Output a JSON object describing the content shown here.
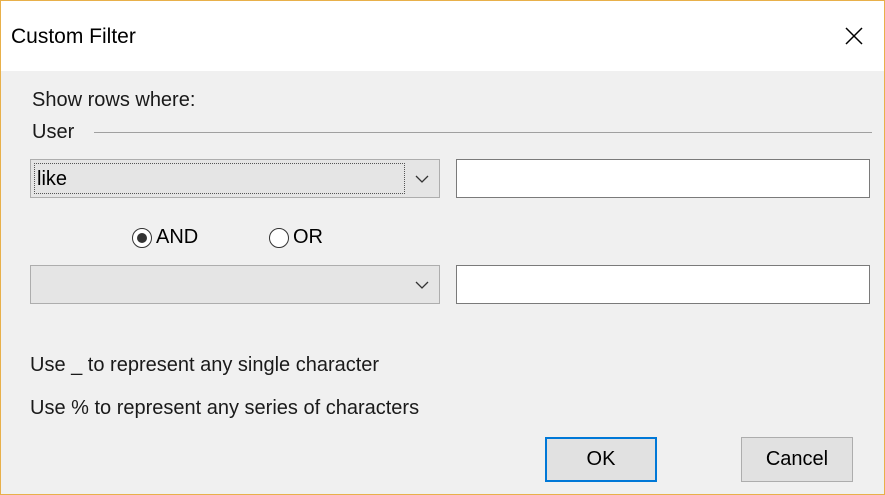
{
  "window": {
    "title": "Custom Filter"
  },
  "dialog": {
    "heading": "Show rows where:",
    "group_label": "User",
    "condition1": {
      "operator": "like",
      "value": ""
    },
    "logic": {
      "and_label": "AND",
      "or_label": "OR",
      "selected": "AND"
    },
    "condition2": {
      "operator": "",
      "value": ""
    },
    "hint1": "Use _ to represent any single character",
    "hint2": "Use % to represent any series of characters"
  },
  "buttons": {
    "ok": "OK",
    "cancel": "Cancel"
  },
  "colors": {
    "accent": "#0078d7",
    "frame": "#e8b04a"
  }
}
